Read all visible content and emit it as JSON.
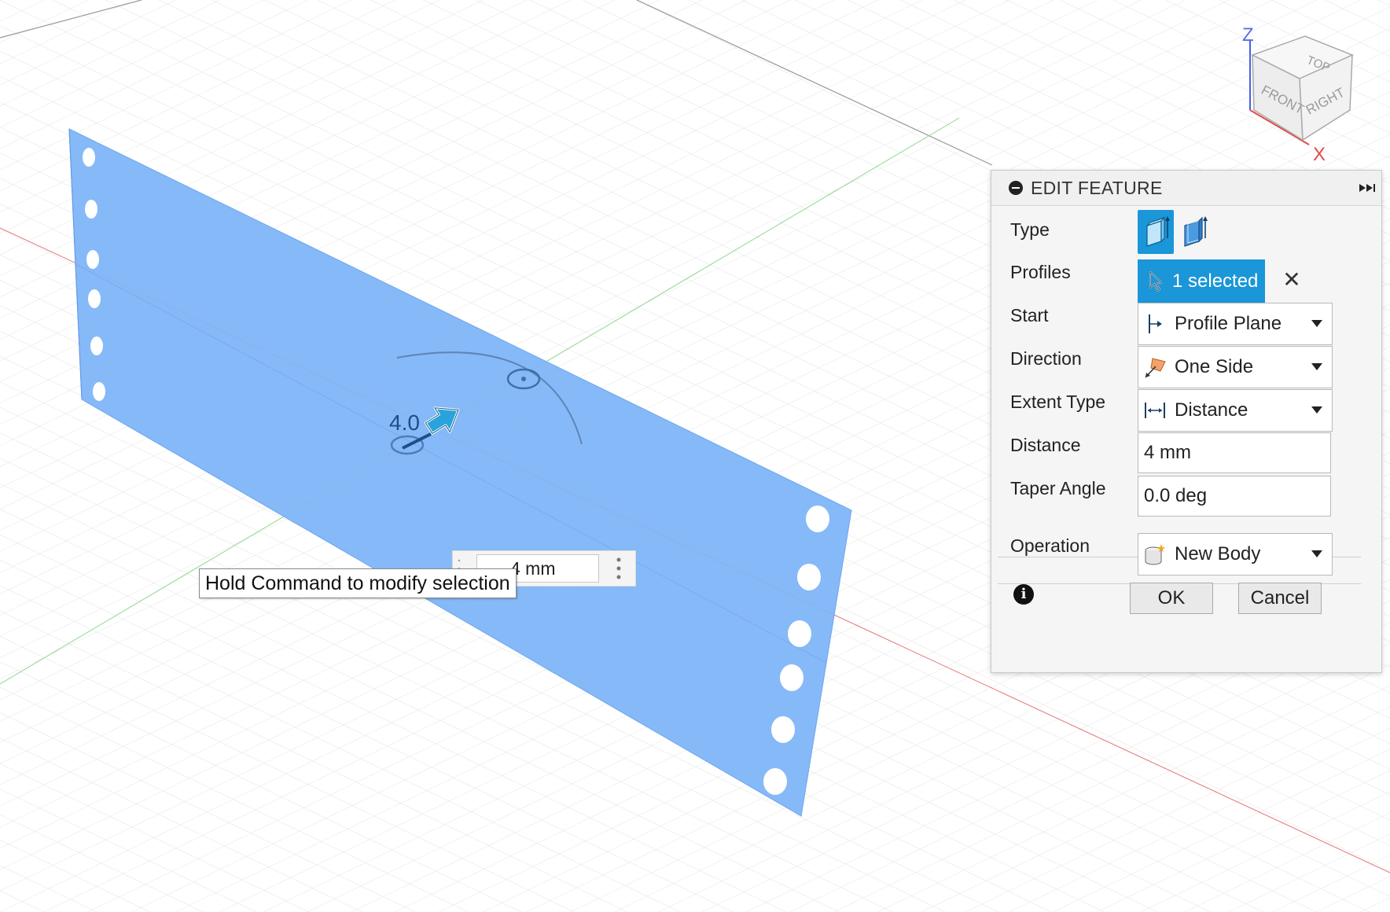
{
  "viewport": {
    "tooltip": "Hold Command to modify selection",
    "distance_manipulator_value": "4 mm",
    "dimension_label": "4.0",
    "viewcube": {
      "top": "TOP",
      "front": "FRONT",
      "right": "RIGHT",
      "axis_z": "Z",
      "axis_x": "X"
    }
  },
  "panel": {
    "title": "EDIT FEATURE",
    "rows": {
      "type": "Type",
      "profiles": "Profiles",
      "start": "Start",
      "direction": "Direction",
      "extent_type": "Extent Type",
      "distance": "Distance",
      "taper_angle": "Taper Angle",
      "operation": "Operation"
    },
    "profiles_value": "1 selected",
    "start_value": "Profile Plane",
    "direction_value": "One Side",
    "extent_type_value": "Distance",
    "distance_value": "4 mm",
    "taper_angle_value": "0.0 deg",
    "operation_value": "New Body",
    "ok_label": "OK",
    "cancel_label": "Cancel"
  },
  "colors": {
    "accent": "#1a96d9",
    "profile_fill": "#7fb5f7",
    "grid": "#dcdcdc",
    "x_axis": "#e57373",
    "y_axis": "#8fd58f"
  },
  "icons": [
    "collapse-icon",
    "expand-panel-icon",
    "extrude-solid-icon",
    "extrude-thin-icon",
    "select-cursor-icon",
    "clear-icon",
    "profile-plane-icon",
    "one-side-icon",
    "distance-icon",
    "new-body-icon",
    "info-icon",
    "drag-arrow-icon"
  ]
}
